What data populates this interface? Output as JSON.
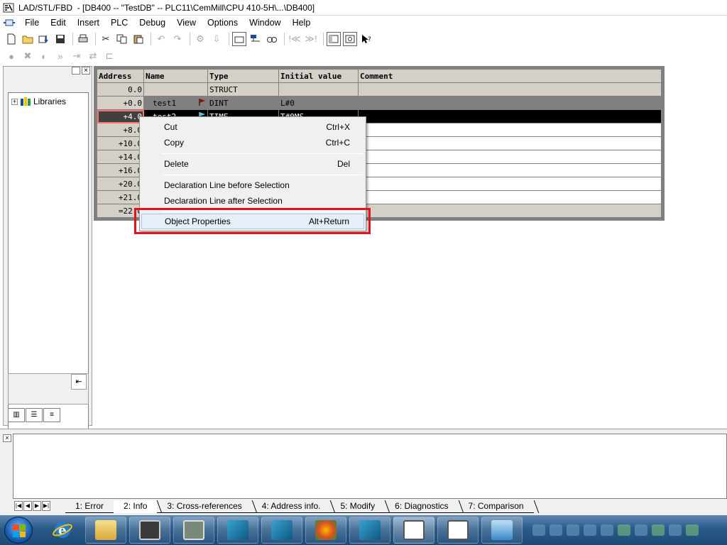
{
  "window": {
    "title": "LAD/STL/FBD  - [DB400 -- \"TestDB\" -- PLC11\\CemMill\\CPU 410-5H\\...\\DB400]"
  },
  "menubar": {
    "items": [
      "File",
      "Edit",
      "Insert",
      "PLC",
      "Debug",
      "View",
      "Options",
      "Window",
      "Help"
    ]
  },
  "left_panel": {
    "tree_root_label": "Libraries",
    "expander": "+"
  },
  "declaration_table": {
    "headers": {
      "address": "Address",
      "name": "Name",
      "type": "Type",
      "initial": "Initial value",
      "comment": "Comment"
    },
    "rows": [
      {
        "address": "0.0",
        "name": "",
        "type": "STRUCT",
        "initial": "",
        "comment": ""
      },
      {
        "address": "+0.0",
        "name": "test1",
        "type": "DINT",
        "initial": "L#0",
        "comment": ""
      },
      {
        "address": "+4.0",
        "name": "test2",
        "type": "TIME",
        "initial": "T#0MS",
        "comment": ""
      },
      {
        "address": "+8.0",
        "name": "",
        "type": "",
        "initial": "",
        "comment": ""
      },
      {
        "address": "+10.0",
        "name": "",
        "type": "",
        "initial": "",
        "comment": ""
      },
      {
        "address": "+14.0",
        "name": "",
        "type": "",
        "initial": "",
        "comment": ""
      },
      {
        "address": "+16.0",
        "name": "",
        "type": "",
        "initial": "",
        "comment": ""
      },
      {
        "address": "+20.0",
        "name": "",
        "type": "",
        "initial": "",
        "comment": ""
      },
      {
        "address": "+21.0",
        "name": "",
        "type": "",
        "initial": "",
        "comment": ""
      },
      {
        "address": "=22.0",
        "name": "",
        "type": "",
        "initial": "",
        "comment": ""
      }
    ],
    "selected_row_index": 2
  },
  "context_menu": {
    "items": [
      {
        "label": "Cut",
        "shortcut": "Ctrl+X"
      },
      {
        "label": "Copy",
        "shortcut": "Ctrl+C"
      },
      {
        "label": "Delete",
        "shortcut": "Del"
      },
      {
        "label": "Declaration Line before Selection",
        "shortcut": ""
      },
      {
        "label": "Declaration Line after Selection",
        "shortcut": ""
      },
      {
        "label": "Object Properties",
        "shortcut": "Alt+Return"
      }
    ],
    "highlighted_item": "Object Properties",
    "highlight_color": "#e0141e"
  },
  "output_pane": {
    "tabs": [
      "1: Error",
      "2: Info",
      "3: Cross-references",
      "4: Address info.",
      "5: Modify",
      "6: Diagnostics",
      "7: Comparison"
    ],
    "active_tab": "2: Info"
  },
  "taskbar": {
    "apps": [
      "internet-explorer-icon",
      "file-explorer-icon",
      "simatic-manager-icon",
      "hw-config-icon",
      "wincc-icon",
      "netpro-icon",
      "paint-icon",
      "step7-icon",
      "lad-stl-fbd-icon",
      "cfc-icon",
      "image-viewer-icon"
    ]
  },
  "colors": {
    "selection_row_bg": "#000000",
    "grid_header_bg": "#d4d0c8",
    "menu_bg": "#f0f0f0",
    "taskbar_bg": "#2a5a88"
  }
}
